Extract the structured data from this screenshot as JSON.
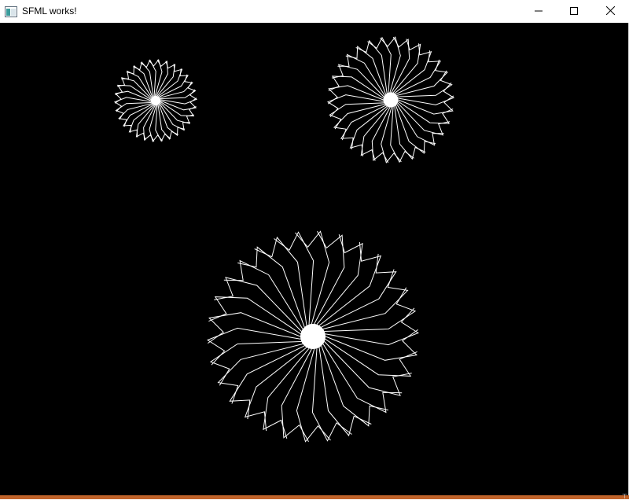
{
  "window": {
    "title": "SFML works!",
    "app_icon": "window-app-icon"
  },
  "controls": {
    "minimize_icon": "minimize-icon",
    "maximize_icon": "maximize-icon",
    "close_icon": "close-icon"
  },
  "canvas": {
    "background": "#000000",
    "stroke": "#ffffff",
    "shapes": [
      {
        "name": "small-spirograph",
        "petals": 30
      },
      {
        "name": "medium-spirograph",
        "petals": 30
      },
      {
        "name": "large-spirograph",
        "petals": 30
      }
    ]
  },
  "taskbar": {
    "color": "#c0632a"
  }
}
